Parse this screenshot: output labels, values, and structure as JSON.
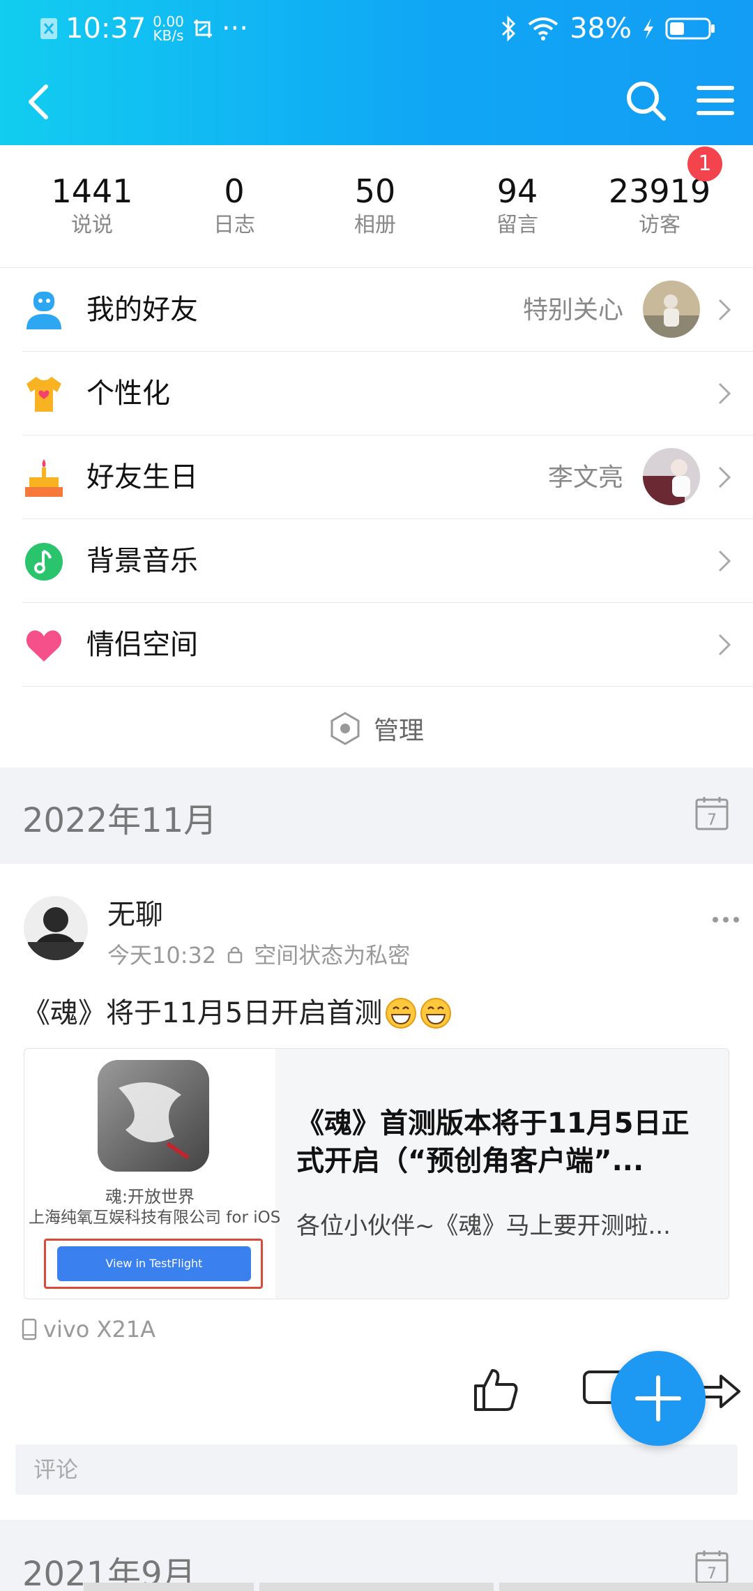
{
  "status_bar": {
    "time": "10:37",
    "net_speed_value": "0.00",
    "net_speed_unit": "KB/s",
    "dots": "···",
    "battery": "38%"
  },
  "stats": [
    {
      "value": "1441",
      "label": "说说"
    },
    {
      "value": "0",
      "label": "日志"
    },
    {
      "value": "50",
      "label": "相册"
    },
    {
      "value": "94",
      "label": "留言"
    },
    {
      "value": "23919",
      "label": "访客"
    }
  ],
  "visitor_badge": "1",
  "menu": {
    "friends": {
      "label": "我的好友",
      "extra": "特别关心"
    },
    "personalize": {
      "label": "个性化"
    },
    "birthday": {
      "label": "好友生日",
      "extra": "李文亮"
    },
    "music": {
      "label": "背景音乐"
    },
    "couple": {
      "label": "情侣空间"
    },
    "manage": "管理"
  },
  "sections": [
    "2022年11月",
    "2021年9月"
  ],
  "calendar_day": "7",
  "post": {
    "author": "无聊",
    "time": "今天10:32",
    "privacy": "空间状态为私密",
    "text": "《魂》将于11月5日开启首测",
    "card": {
      "app_name": "魂:开放世界",
      "company": "上海纯氧互娱科技有限公司 for iOS",
      "button": "View in TestFlight",
      "title": "《魂》首测版本将于11月5日正式开启（“预创角客户端”...",
      "desc": "各位小伙伴~《魂》马上要开测啦..."
    },
    "device": "vivo X21A",
    "comment_placeholder": "评论"
  },
  "colors": {
    "header_start": "#12cdf0",
    "header_end": "#139df5",
    "badge": "#f3434d",
    "fab": "#1d98f3"
  }
}
